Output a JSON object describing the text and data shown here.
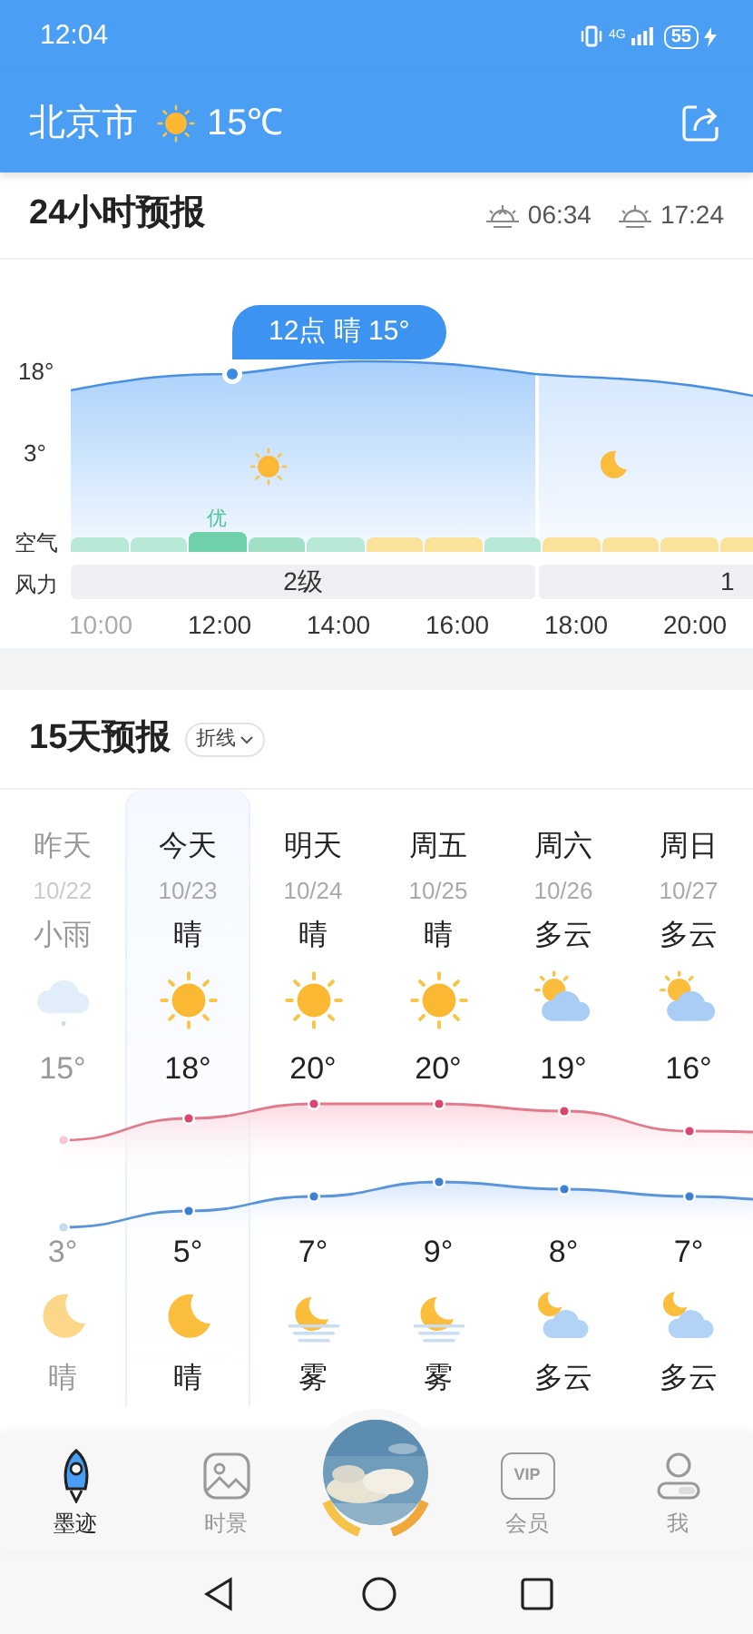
{
  "status_bar": {
    "time": "12:04",
    "network": "4G",
    "battery": "55"
  },
  "header": {
    "city": "北京市",
    "temperature": "15℃"
  },
  "hourly": {
    "title": "24小时预报",
    "sunrise": "06:34",
    "sunset": "17:24",
    "max_label": "18°",
    "min_label": "3°",
    "tooltip": "12点 晴 15°",
    "air_label": "空气",
    "air_quality": "优",
    "wind_label": "风力",
    "air_segments": [
      {
        "color": "#b8e8d6",
        "selected": false
      },
      {
        "color": "#b8e8d6",
        "selected": false
      },
      {
        "color": "#6fd0aa",
        "selected": true
      },
      {
        "color": "#9fe0c7",
        "selected": false
      },
      {
        "color": "#b8e8d6",
        "selected": false
      },
      {
        "color": "#fbe29a",
        "selected": false
      },
      {
        "color": "#fbe29a",
        "selected": false
      },
      {
        "color": "#b8e8d6",
        "selected": false
      },
      {
        "color": "#fbe29a",
        "selected": false
      },
      {
        "color": "#fbe29a",
        "selected": false
      },
      {
        "color": "#fbe29a",
        "selected": false
      },
      {
        "color": "#fbe29a",
        "selected": false
      }
    ],
    "wind": [
      {
        "text": "2级"
      },
      {
        "text": "1"
      }
    ],
    "times": [
      {
        "text": "10:00",
        "past": true
      },
      {
        "text": "12:00",
        "past": false
      },
      {
        "text": "14:00",
        "past": false
      },
      {
        "text": "16:00",
        "past": false
      },
      {
        "text": "18:00",
        "past": false
      },
      {
        "text": "20:00",
        "past": false
      }
    ]
  },
  "daily": {
    "title": "15天预报",
    "mode": "折线",
    "days": [
      {
        "day": "昨天",
        "date": "10/22",
        "day_weather": "小雨",
        "day_icon": {
          "kind": "rain"
        },
        "high": "15°",
        "low": "3°",
        "night_icon": {
          "kind": "moon"
        },
        "night_weather": "晴",
        "past": true,
        "selected": false
      },
      {
        "day": "今天",
        "date": "10/23",
        "day_weather": "晴",
        "day_icon": {
          "kind": "sun"
        },
        "high": "18°",
        "low": "5°",
        "night_icon": {
          "kind": "moon"
        },
        "night_weather": "晴",
        "past": false,
        "selected": true
      },
      {
        "day": "明天",
        "date": "10/24",
        "day_weather": "晴",
        "day_icon": {
          "kind": "sun"
        },
        "high": "20°",
        "low": "7°",
        "night_icon": {
          "kind": "moon-fog"
        },
        "night_weather": "雾",
        "past": false,
        "selected": false
      },
      {
        "day": "周五",
        "date": "10/25",
        "day_weather": "晴",
        "day_icon": {
          "kind": "sun"
        },
        "high": "20°",
        "low": "9°",
        "night_icon": {
          "kind": "moon-fog"
        },
        "night_weather": "雾",
        "past": false,
        "selected": false
      },
      {
        "day": "周六",
        "date": "10/26",
        "day_weather": "多云",
        "day_icon": {
          "kind": "sun-cloud"
        },
        "high": "19°",
        "low": "8°",
        "night_icon": {
          "kind": "moon-cloud"
        },
        "night_weather": "多云",
        "past": false,
        "selected": false
      },
      {
        "day": "周日",
        "date": "10/27",
        "day_weather": "多云",
        "day_icon": {
          "kind": "sun-cloud"
        },
        "high": "16°",
        "low": "7°",
        "night_icon": {
          "kind": "moon-cloud"
        },
        "night_weather": "多云",
        "past": false,
        "selected": false
      }
    ]
  },
  "bottom_nav": [
    {
      "label": "墨迹",
      "kind": "rocket",
      "selected": true
    },
    {
      "label": "时景",
      "selected": false
    },
    {
      "kind": "center"
    },
    {
      "label": "会员",
      "kind": "vip",
      "badge": "VIP",
      "selected": false
    },
    {
      "label": "我",
      "kind": "person",
      "selected": false
    }
  ]
}
